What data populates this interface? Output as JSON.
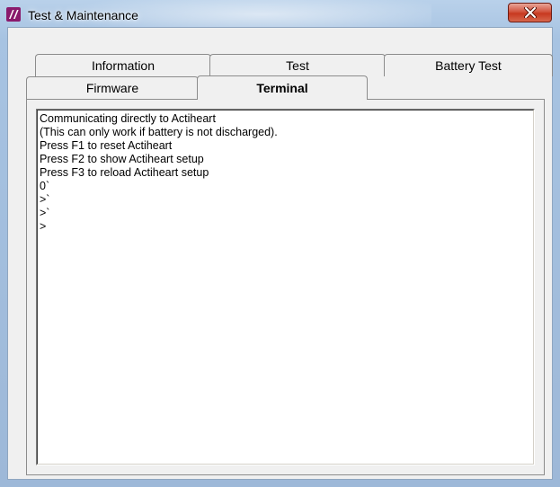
{
  "window": {
    "title": "Test & Maintenance",
    "colors": {
      "icon_bg": "#8a1a6c",
      "close_button": "#c7381f"
    }
  },
  "tabs": {
    "row_back": [
      {
        "label": "Information"
      },
      {
        "label": "Test"
      },
      {
        "label": "Battery Test"
      }
    ],
    "row_front": [
      {
        "label": "Firmware"
      },
      {
        "label": "Terminal",
        "selected": true
      }
    ]
  },
  "terminal": {
    "lines": [
      "Communicating directly to Actiheart",
      "(This can only work if battery is not discharged).",
      "Press F1 to reset Actiheart",
      "Press F2 to show Actiheart setup",
      "Press F3 to reload Actiheart setup",
      "0`",
      ">`",
      ">`",
      ">"
    ]
  }
}
